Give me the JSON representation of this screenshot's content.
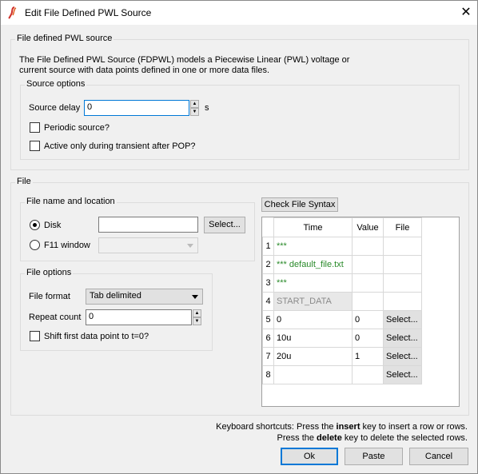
{
  "window": {
    "title": "Edit File Defined PWL Source",
    "close_symbol": "✕",
    "app_icon": "ltspice-app-icon",
    "accent_color": "#0078d7"
  },
  "pwl": {
    "legend": "File defined PWL source",
    "description_line1": "The File Defined PWL Source (FDPWL) models a Piecewise Linear (PWL) voltage or",
    "description_line2": "current source with data points defined in one or more data files.",
    "source_options": {
      "legend": "Source options",
      "delay_label": "Source delay",
      "delay_value": "0",
      "delay_unit": "s",
      "periodic_label": "Periodic source?",
      "periodic_checked": false,
      "active_label": "Active only during transient after POP?",
      "active_checked": false
    }
  },
  "file": {
    "legend": "File",
    "location": {
      "legend": "File name and location",
      "disk_label": "Disk",
      "disk_selected": true,
      "disk_value": "",
      "select_label": "Select...",
      "f11_label": "F11 window",
      "f11_value": ""
    },
    "options": {
      "legend": "File options",
      "format_label": "File format",
      "format_value": "Tab delimited",
      "repeat_label": "Repeat count",
      "repeat_value": "0",
      "shift_label": "Shift first data point to t=0?",
      "shift_checked": false
    },
    "check_syntax_label": "Check File Syntax",
    "grid": {
      "columns": [
        "Time",
        "Value",
        "File"
      ],
      "rows": [
        {
          "num": "1",
          "time": "***",
          "value": "",
          "file": ""
        },
        {
          "num": "2",
          "time": "*** default_file.txt",
          "value": "",
          "file": ""
        },
        {
          "num": "3",
          "time": "***",
          "value": "",
          "file": ""
        },
        {
          "num": "4",
          "time": "START_DATA",
          "value": "",
          "file": ""
        },
        {
          "num": "5",
          "time": "0",
          "value": "0",
          "file": "Select..."
        },
        {
          "num": "6",
          "time": "10u",
          "value": "0",
          "file": "Select..."
        },
        {
          "num": "7",
          "time": "20u",
          "value": "1",
          "file": "Select..."
        },
        {
          "num": "8",
          "time": "",
          "value": "",
          "file": "Select..."
        }
      ]
    }
  },
  "shortcuts": {
    "line1_pre": "Keyboard shortcuts: Press the ",
    "line1_key": "insert",
    "line1_post": " key to insert a row or rows.",
    "line2_pre": "Press the ",
    "line2_key": "delete",
    "line2_post": " key to delete the selected rows."
  },
  "buttons": {
    "ok": "Ok",
    "paste": "Paste",
    "cancel": "Cancel"
  }
}
